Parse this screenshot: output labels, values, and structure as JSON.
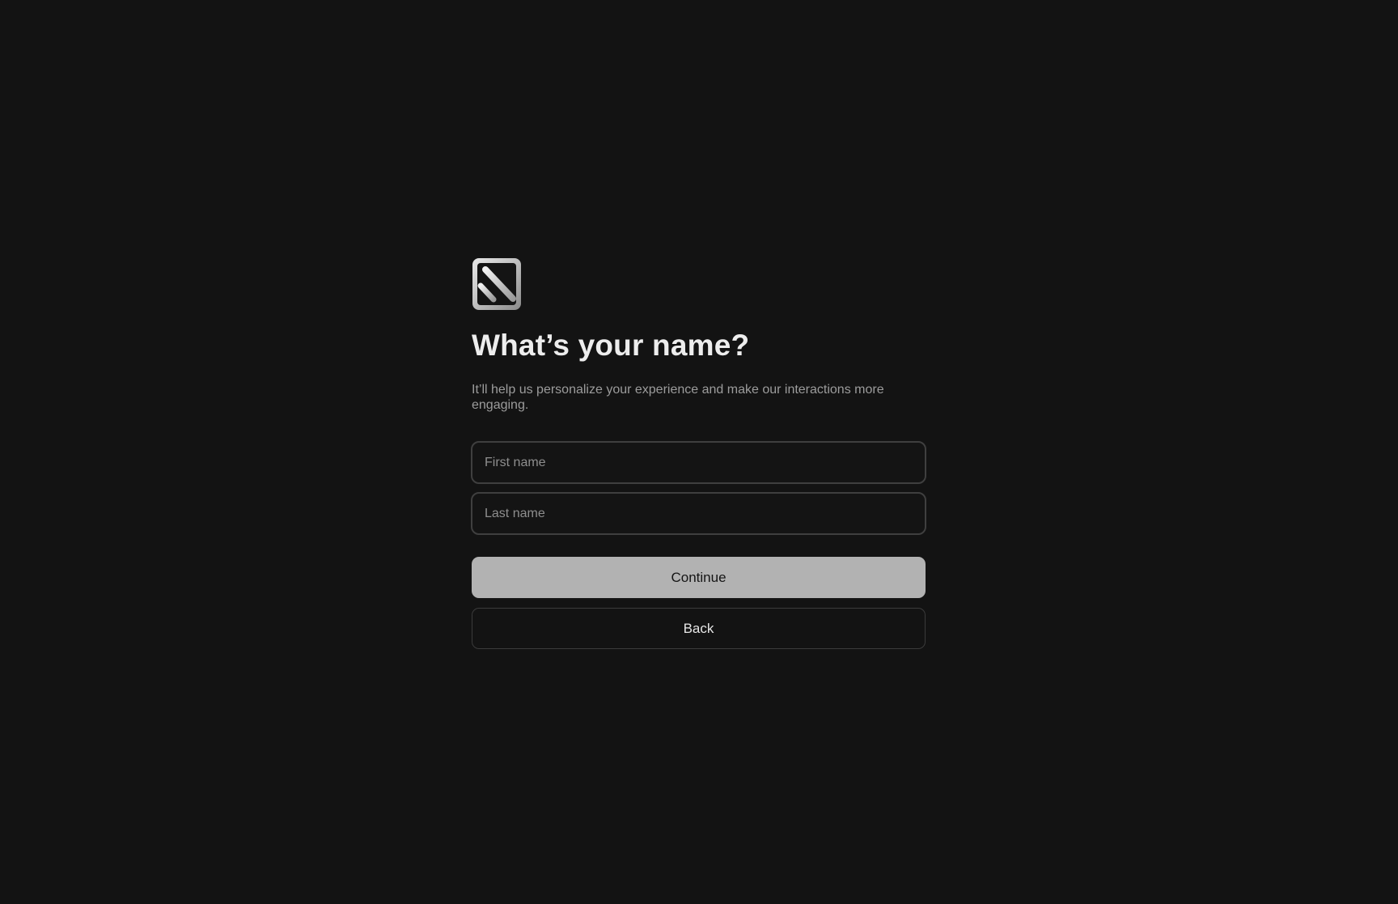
{
  "logo": {
    "icon": "app-logo-icon"
  },
  "heading": {
    "title": "What’s your name?",
    "subtitle": "It’ll help us personalize your experience and make our interactions more engaging."
  },
  "form": {
    "first_name": {
      "placeholder": "First name",
      "value": ""
    },
    "last_name": {
      "placeholder": "Last name",
      "value": ""
    }
  },
  "actions": {
    "continue_label": "Continue",
    "back_label": "Back"
  },
  "colors": {
    "background": "#131313",
    "continue_button": "#b2b2b2",
    "input_border": "#3f3f3f"
  }
}
